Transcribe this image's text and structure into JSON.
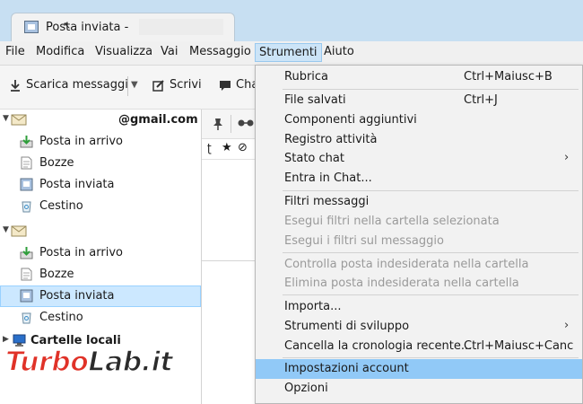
{
  "window": {
    "tab_title": "Posta inviata -"
  },
  "menubar": {
    "items": [
      "File",
      "Modifica",
      "Visualizza",
      "Vai",
      "Messaggio",
      "Strumenti",
      "Aiuto"
    ],
    "active": "Strumenti"
  },
  "toolbar": {
    "download_label": "Scarica messaggi",
    "write_label": "Scrivi",
    "chat_label": "Cha"
  },
  "folders": {
    "account1_name": "@gmail.com",
    "account1_items": [
      "Posta in arrivo",
      "Bozze",
      "Posta inviata",
      "Cestino"
    ],
    "account2_items": [
      "Posta in arrivo",
      "Bozze",
      "Posta inviata",
      "Cestino"
    ],
    "local_label": "Cartelle locali",
    "selected": "Posta inviata"
  },
  "strumenti_menu": {
    "items": [
      {
        "label": "Rubrica",
        "shortcut": "Ctrl+Maiusc+B"
      },
      {
        "label": "File salvati",
        "shortcut": "Ctrl+J"
      },
      {
        "label": "Componenti aggiuntivi",
        "shortcut": ""
      },
      {
        "label": "Registro attività",
        "shortcut": ""
      },
      {
        "label": "Stato chat",
        "shortcut": "",
        "submenu": true
      },
      {
        "label": "Entra in Chat...",
        "shortcut": ""
      },
      {
        "label": "Filtri messaggi",
        "shortcut": ""
      },
      {
        "label": "Esegui filtri nella cartella selezionata",
        "shortcut": "",
        "disabled": true
      },
      {
        "label": "Esegui i filtri sul messaggio",
        "shortcut": "",
        "disabled": true
      },
      {
        "label": "Controlla posta indesiderata nella cartella",
        "shortcut": "",
        "disabled": true
      },
      {
        "label": "Elimina posta indesiderata nella cartella",
        "shortcut": "",
        "disabled": true
      },
      {
        "label": "Importa...",
        "shortcut": ""
      },
      {
        "label": "Strumenti di sviluppo",
        "shortcut": "",
        "submenu": true
      },
      {
        "label": "Cancella la cronologia recente...",
        "shortcut": "Ctrl+Maiusc+Canc"
      },
      {
        "label": "Impostazioni account",
        "shortcut": "",
        "highlighted": true
      },
      {
        "label": "Opzioni",
        "shortcut": ""
      }
    ],
    "submenu_arrow": "›"
  },
  "watermark": {
    "part1": "Turbo",
    "part2": "Lab.it"
  },
  "colors": {
    "titlebar": "#c7dff2",
    "menu_highlight": "#91c9f7",
    "selected_folder": "#cce8ff",
    "watermark_red": "#e03228"
  }
}
